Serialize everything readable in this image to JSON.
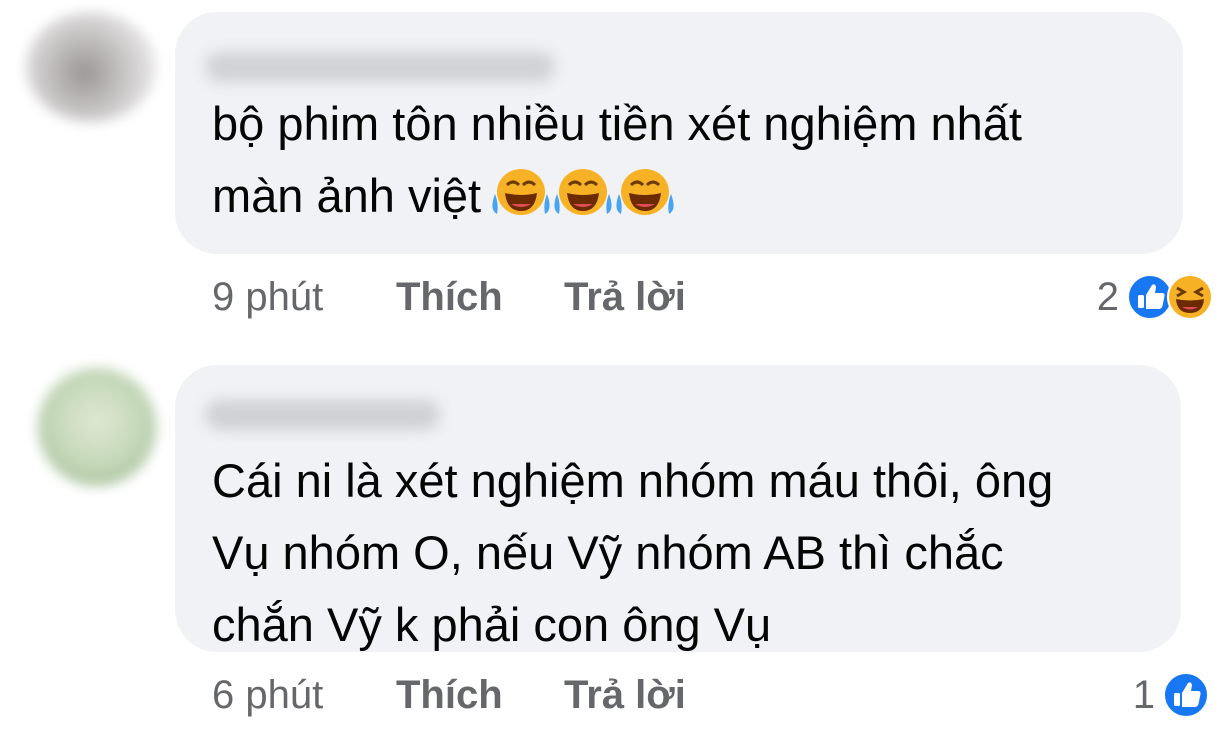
{
  "comments": [
    {
      "text_lines": [
        "bộ phim tôn nhiều tiền xét nghiệm nhất",
        "màn ảnh việt"
      ],
      "emojis": [
        "crying-laughing-emoji",
        "crying-laughing-emoji",
        "crying-laughing-emoji"
      ],
      "time": "9 phút",
      "like_label": "Thích",
      "reply_label": "Trả lời",
      "reaction_count": "2",
      "reactions": [
        "like-reaction-icon",
        "haha-reaction-icon"
      ]
    },
    {
      "text_lines": [
        "Cái ni là xét nghiệm nhóm máu thôi, ông",
        "Vụ nhóm O, nếu Vỹ nhóm AB thì chắc",
        "chắn Vỹ k phải con ông Vụ"
      ],
      "time": "6 phút",
      "like_label": "Thích",
      "reply_label": "Trả lời",
      "reaction_count": "1",
      "reactions": [
        "like-reaction-icon"
      ]
    }
  ],
  "colors": {
    "bubble_bg": "#f0f2f5",
    "text": "#050505",
    "secondary_text": "#65676b",
    "like_blue": "#1877f2",
    "haha_yellow": "#f7b125"
  }
}
